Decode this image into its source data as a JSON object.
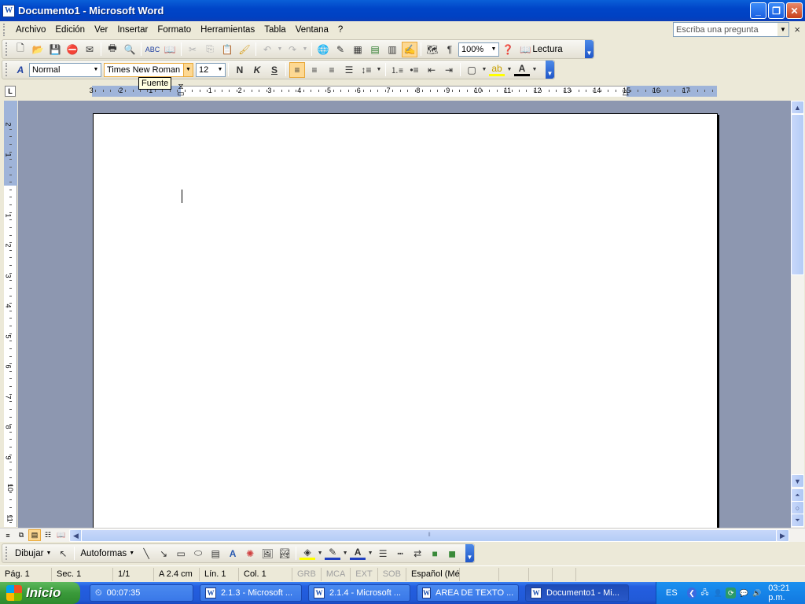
{
  "window": {
    "title": "Documento1 - Microsoft Word",
    "app_icon": "W",
    "minimize": "_",
    "maximize": "❐",
    "close": "✕"
  },
  "menubar": {
    "items": [
      "Archivo",
      "Edición",
      "Ver",
      "Insertar",
      "Formato",
      "Herramientas",
      "Tabla",
      "Ventana",
      "?"
    ],
    "ask_placeholder": "Escriba una pregunta",
    "close_doc": "×"
  },
  "standard_toolbar": {
    "zoom": "100%",
    "reading_label": "Lectura"
  },
  "format_toolbar": {
    "style": "Normal",
    "font": "Times New Roman",
    "size": "12",
    "bold": "N",
    "italic": "K",
    "underline": "S"
  },
  "tooltip": "Fuente",
  "ruler": {
    "h_left_numbers": [
      "3",
      "2",
      "1"
    ],
    "h_numbers": [
      "1",
      "2",
      "3",
      "4",
      "5",
      "6",
      "7",
      "8",
      "9",
      "10",
      "11",
      "12",
      "13",
      "14",
      "15",
      "16",
      "17"
    ],
    "v_top_numbers": [
      "2",
      "1"
    ],
    "v_numbers": [
      "1",
      "2",
      "3",
      "4",
      "5",
      "6",
      "7",
      "8",
      "9",
      "10",
      "11"
    ],
    "tab_selector": "L"
  },
  "drawing_toolbar": {
    "draw": "Dibujar",
    "autoshapes": "Autoformas"
  },
  "statusbar": {
    "page": "Pág. 1",
    "section": "Sec. 1",
    "pages": "1/1",
    "at": "A 2.4 cm",
    "line": "Lín. 1",
    "col": "Col. 1",
    "rec": "GRB",
    "trk": "MCA",
    "ext": "EXT",
    "ovr": "SOB",
    "lang": "Español (Mé"
  },
  "taskbar": {
    "start": "Inicio",
    "tasks": [
      {
        "label": "00:07:35",
        "icon": "clock-icon"
      },
      {
        "label": "2.1.3 - Microsoft ...",
        "icon": "word-icon"
      },
      {
        "label": "2.1.4 - Microsoft ...",
        "icon": "word-icon"
      },
      {
        "label": "AREA DE TEXTO ...",
        "icon": "word-icon"
      },
      {
        "label": "Documento1 - Mi...",
        "icon": "word-icon"
      }
    ],
    "lang": "ES",
    "clock": "03:21 p.m."
  }
}
